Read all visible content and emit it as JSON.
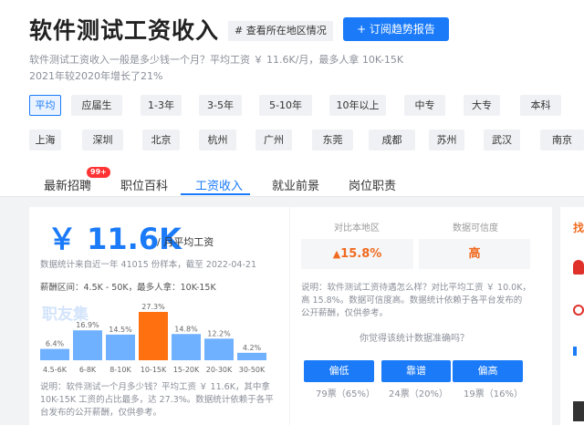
{
  "header": {
    "title": "软件测试工资收入",
    "region_tag": "# 查看所在地区情况",
    "subscribe_button": "+ 订阅趋势报告",
    "desc1": "软件测试工资收入一般是多少钱一个月？平均工资 ￥ 11.6K/月，最多人拿 10K-15K",
    "desc2": "2021年较2020年增长了21%"
  },
  "filters": {
    "experience": [
      "平均",
      "应届生",
      "1-3年",
      "3-5年",
      "5-10年",
      "10年以上",
      "中专",
      "大专",
      "本科"
    ],
    "cities": [
      "上海",
      "深圳",
      "北京",
      "杭州",
      "广州",
      "东莞",
      "成都",
      "苏州",
      "武汉",
      "南京"
    ]
  },
  "tabs": [
    "最新招聘",
    "职位百科",
    "工资收入",
    "就业前景",
    "岗位职责"
  ],
  "hot_badge": "99+",
  "salary": {
    "amount": "￥ 11.6K",
    "per_month": "/ 月平均工资",
    "source_note": "数据统计来自近一年 41015 份样本，截至 2022-04-21",
    "range_text": "薪酬区间：4.5K - 50K，最多人拿：10K-15K",
    "watermark": "职友集",
    "footnote1": "说明：软件测试一个月多少钱？平均工资 ￥ 11.6K，其中拿",
    "footnote2": "10K-15K 工资的占比最多，达 27.3%。数据统计依赖于各平",
    "footnote3": "台发布的公开薪酬，仅供参考。"
  },
  "compare": {
    "region_label": "对比本地区",
    "trust_label": "数据可信度",
    "region_value": "15.8%",
    "trust_value": "高",
    "note1": "说明：软件测试工资待遇怎么样？对比平均工资 ￥ 10.0K，",
    "note2": "高 15.8%。数据可信度高。数据统计依赖于各平台发布的",
    "note3": "公开薪酬，仅供参考。",
    "question": "你觉得该统计数据准确吗？",
    "votes": [
      {
        "label": "偏低",
        "count": "79票（65%）"
      },
      {
        "label": "靠谱",
        "count": "24票（20%）"
      },
      {
        "label": "偏高",
        "count": "19票（16%）"
      }
    ]
  },
  "sidebar_peek": "找",
  "colors": {
    "accent": "#1a7af8",
    "bar": "#6fb1ff",
    "bar_highlight": "#ff7010",
    "up": "#f06b20"
  },
  "chart_data": {
    "type": "bar",
    "categories": [
      "4.5-6K",
      "6-8K",
      "8-10K",
      "10-15K",
      "15-20K",
      "20-30K",
      "30-50K"
    ],
    "values": [
      6.4,
      16.9,
      14.5,
      27.3,
      14.8,
      12.2,
      4.2
    ],
    "value_labels": [
      "6.4%",
      "16.9%",
      "14.5%",
      "27.3%",
      "14.8%",
      "12.2%",
      "4.2%"
    ],
    "highlight_index": 3,
    "ylim": [
      0,
      27.3
    ]
  }
}
